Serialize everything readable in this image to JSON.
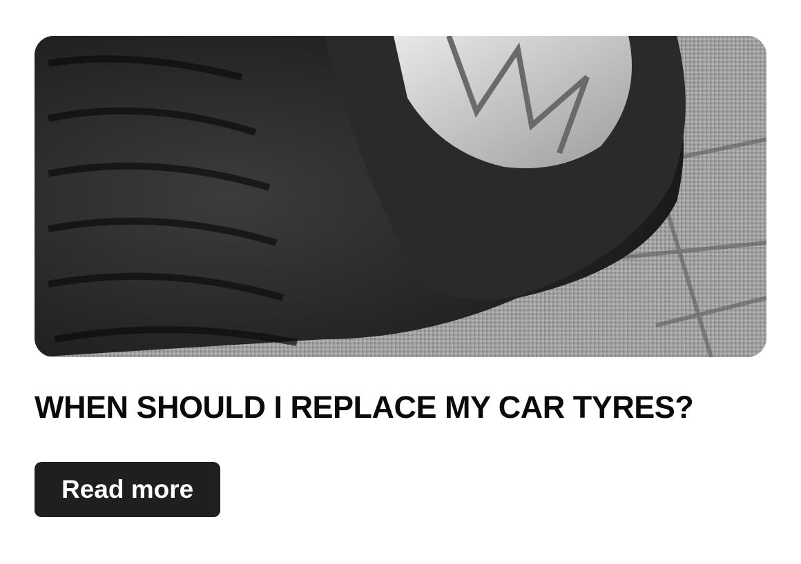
{
  "article": {
    "image_subject": "flat-car-tyre-photo",
    "title": "WHEN SHOULD I REPLACE MY CAR TYRES?",
    "read_more_label": "Read more"
  },
  "colors": {
    "background": "#ffffff",
    "title_text": "#0a0a0a",
    "button_bg": "#1f1f1f",
    "button_text": "#ffffff"
  }
}
